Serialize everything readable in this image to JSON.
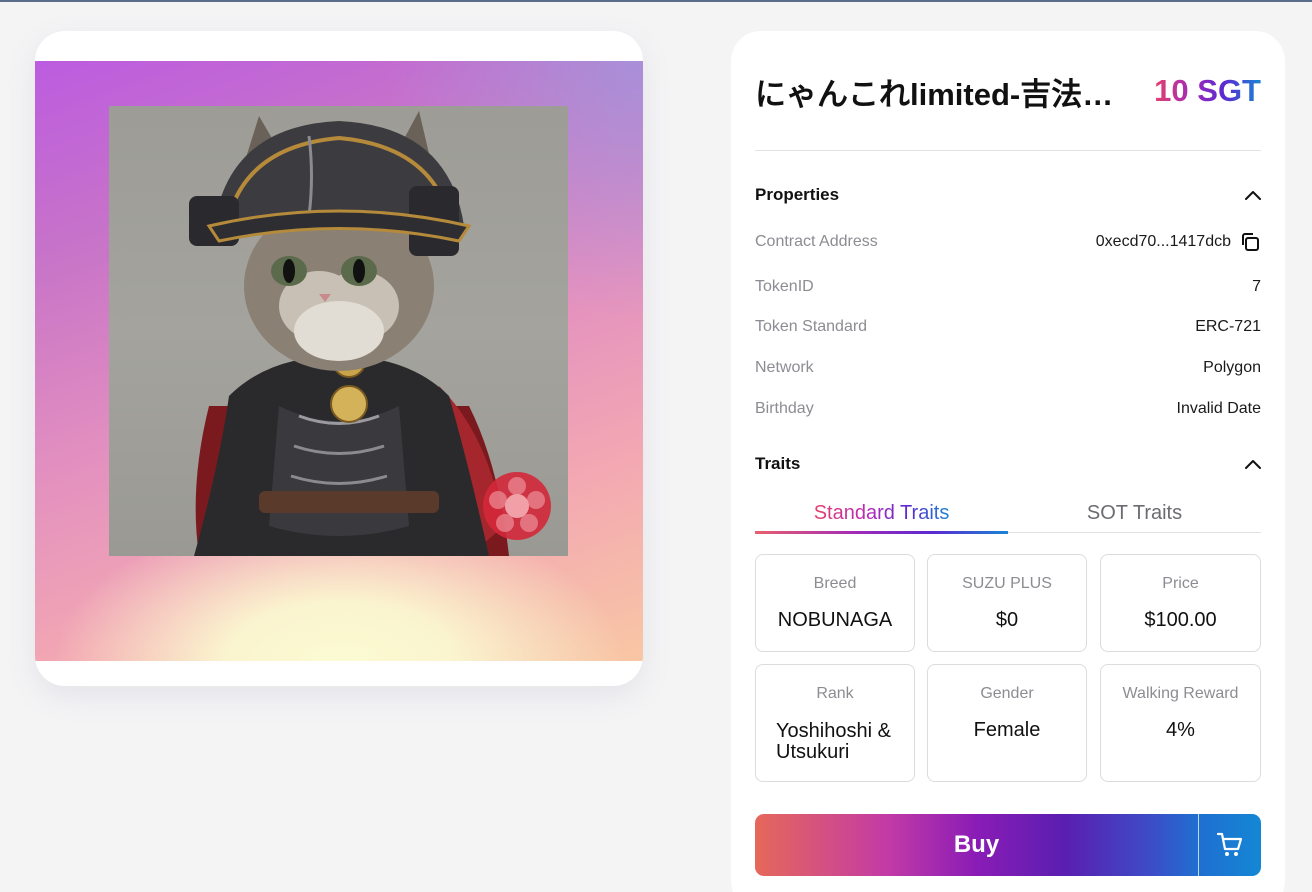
{
  "nft": {
    "title": "にゃんこれlimited-吉法…",
    "price": "10 SGT",
    "image_alt": "Samurai cat wearing armor and helmet"
  },
  "properties": {
    "heading": "Properties",
    "rows": [
      {
        "key": "Contract Address",
        "value": "0xecd70...1417dcb"
      },
      {
        "key": "TokenID",
        "value": "7"
      },
      {
        "key": "Token Standard",
        "value": "ERC-721"
      },
      {
        "key": "Network",
        "value": "Polygon"
      },
      {
        "key": "Birthday",
        "value": "Invalid Date"
      }
    ]
  },
  "traits": {
    "heading": "Traits",
    "tabs": [
      {
        "label": "Standard Traits",
        "active": true
      },
      {
        "label": "SOT Traits",
        "active": false
      }
    ],
    "items": [
      {
        "key": "Breed",
        "value": "NOBUNAGA"
      },
      {
        "key": "SUZU PLUS",
        "value": "$0"
      },
      {
        "key": "Price",
        "value": "$100.00"
      },
      {
        "key": "Rank",
        "value": "Yoshihoshi & Utsukuri"
      },
      {
        "key": "Gender",
        "value": "Female"
      },
      {
        "key": "Walking Reward",
        "value": "4%"
      }
    ]
  },
  "actions": {
    "buy_label": "Buy",
    "cart_icon": "cart-icon"
  },
  "icons": {
    "collapse": "chevron-up-icon",
    "copy": "copy-icon"
  },
  "colors": {
    "accent_start": "#e5406c",
    "accent_mid": "#8a1cb6",
    "accent_end": "#1a84d4"
  }
}
